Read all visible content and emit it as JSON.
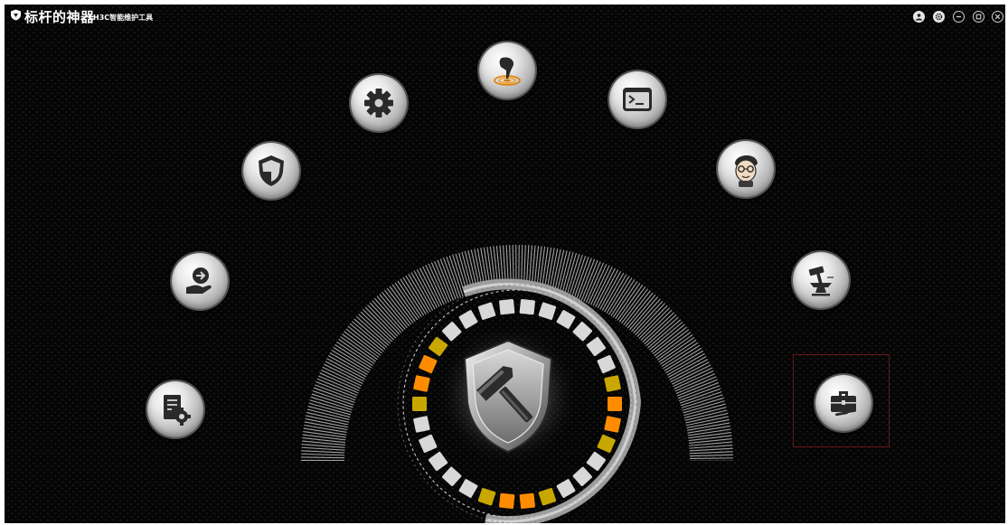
{
  "app": {
    "title": "标杆的神器",
    "subtitle": "H3C智能维护工具"
  },
  "window_controls": [
    "user-icon",
    "settings-icon",
    "minimize-icon",
    "maximize-icon",
    "close-icon"
  ],
  "tools": [
    "settings-gear-icon",
    "touch-target-icon",
    "terminal-icon",
    "security-shield-icon",
    "engineer-avatar-icon",
    "export-hand-icon",
    "hammer-anvil-icon",
    "config-document-icon",
    "toolbox-icon"
  ],
  "selected_tool": "toolbox-icon",
  "colors": {
    "accent_orange": "#ff8c00",
    "accent_yellow": "#c8a800",
    "selection_border": "#6b1515"
  }
}
